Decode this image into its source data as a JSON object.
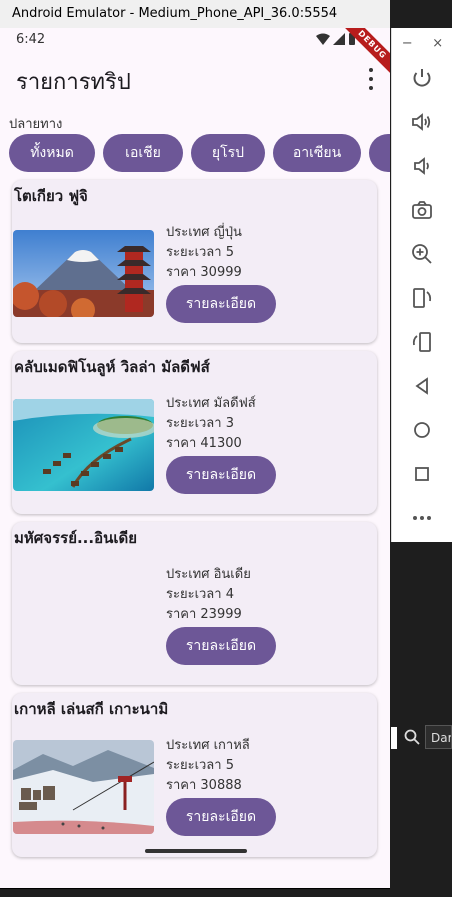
{
  "window": {
    "title": "Android Emulator - Medium_Phone_API_36.0:5554"
  },
  "status": {
    "time": "6:42",
    "debug_label": "DEBUG"
  },
  "appbar": {
    "title": "รายการทริป"
  },
  "filter": {
    "label": "ปลายทาง",
    "chips": [
      "ทั้งหมด",
      "เอเชีย",
      "ยุโรป",
      "อาเซียน"
    ]
  },
  "trips": [
    {
      "title": "โตเกียว ฟูจิ",
      "country": "ประเทศ ญี่ปุ่น",
      "duration": "ระยะเวลา 5",
      "price": "ราคา 30999",
      "button": "รายละเอียด",
      "image": "mt-fuji-pagoda"
    },
    {
      "title": "คลับเมดฟิโนลูห์ วิลล่า มัลดีฟส์",
      "country": "ประเทศ มัลดีฟส์",
      "duration": "ระยะเวลา 3",
      "price": "ราคา 41300",
      "button": "รายละเอียด",
      "image": "maldives-water-villas"
    },
    {
      "title": "มหัศจรรย์...อินเดีย",
      "country": "ประเทศ อินเดีย",
      "duration": "ระยะเวลา 4",
      "price": "ราคา 23999",
      "button": "รายละเอียด",
      "image": ""
    },
    {
      "title": "เกาหลี เล่นสกี เกาะนามิ",
      "country": "ประเทศ เกาหลี",
      "duration": "ระยะเวลา 5",
      "price": "ราคา 30888",
      "button": "รายละเอียด",
      "image": "ski-resort"
    }
  ],
  "emulator_toolbar": {
    "minimize": "−",
    "close": "×",
    "icons": [
      "power-icon",
      "volume-up-icon",
      "volume-down-icon",
      "camera-icon",
      "zoom-in-icon",
      "rotate-left-icon",
      "rotate-right-icon",
      "back-icon",
      "home-icon",
      "overview-icon",
      "more-icon"
    ]
  },
  "ide": {
    "search_box_text": "Dar"
  }
}
